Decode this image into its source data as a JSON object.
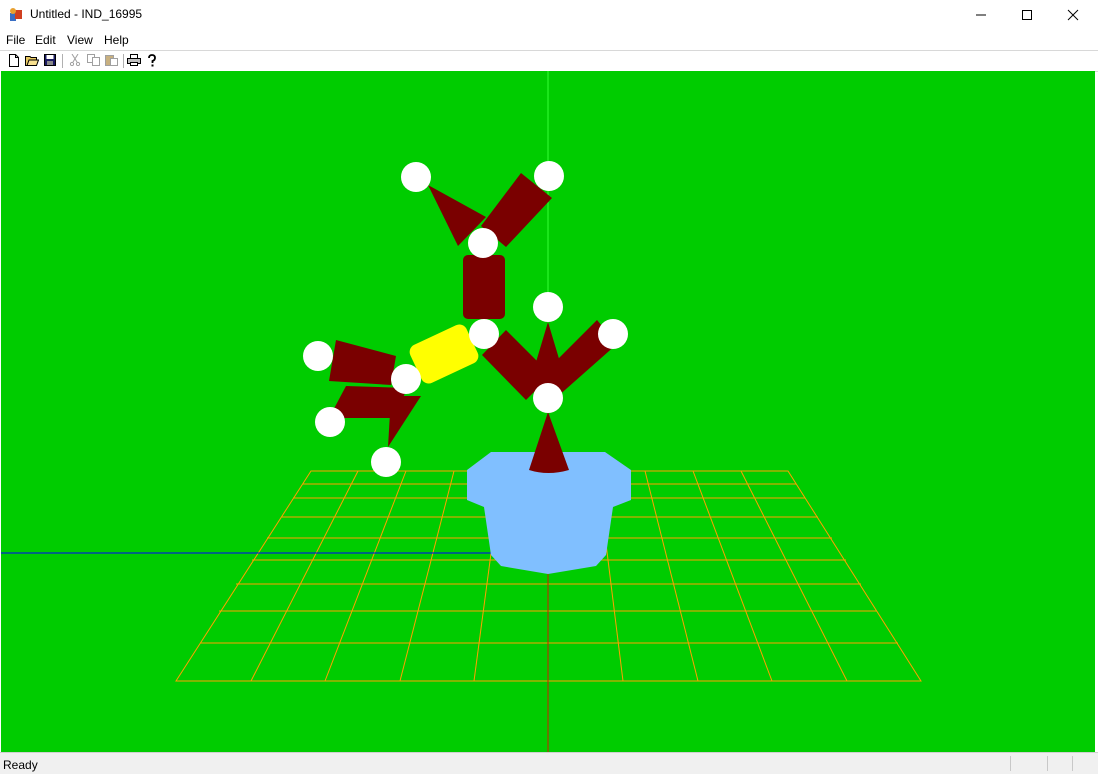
{
  "window": {
    "title": "Untitled - IND_16995",
    "app_icon": "app-icon",
    "controls": [
      "minimize-icon",
      "maximize-icon",
      "close-icon"
    ]
  },
  "menu": {
    "file": "File",
    "edit": "Edit",
    "view": "View",
    "help": "Help"
  },
  "toolbar": {
    "buttons": [
      {
        "name": "new-icon",
        "enabled": true
      },
      {
        "name": "open-icon",
        "enabled": true
      },
      {
        "name": "save-icon",
        "enabled": true
      },
      {
        "name": "cut-icon",
        "enabled": false
      },
      {
        "name": "copy-icon",
        "enabled": false
      },
      {
        "name": "paste-icon",
        "enabled": false
      },
      {
        "name": "print-icon",
        "enabled": true
      },
      {
        "name": "help-icon",
        "enabled": true
      }
    ]
  },
  "scene": {
    "background_color": "#00cc00",
    "grid_color": "#ffa500",
    "link_color": "#7a0000",
    "joint_color": "#ffffff",
    "highlight_link_color": "#ffff00",
    "base_color": "#80bfff",
    "axes": {
      "x": "#0000ff",
      "y": "#00ff00",
      "z": "#ff0000"
    }
  },
  "status": {
    "text": "Ready"
  }
}
